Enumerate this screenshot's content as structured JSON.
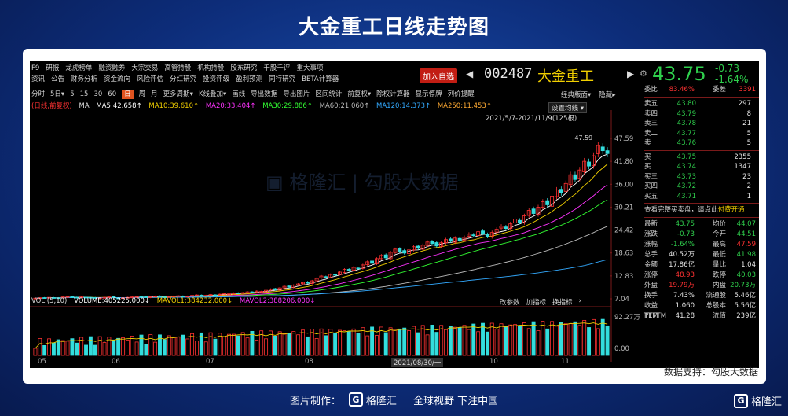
{
  "page": {
    "title": "大金重工日线走势图",
    "data_source": "数据支持：勾股大数据",
    "footer_made_by": "图片制作：",
    "footer_brand": "格隆汇",
    "footer_slogan": "全球视野 下注中国",
    "corner_brand": "格隆汇"
  },
  "nav": {
    "row1": [
      "F9",
      "研报",
      "龙虎榜单",
      "融资融券",
      "大宗交易",
      "高管持股",
      "机构持股",
      "股东研究",
      "千股千评",
      "重大事项"
    ],
    "row2": [
      "资讯",
      "公告",
      "财务分析",
      "资金流向",
      "风险评估",
      "分红研究",
      "投资评级",
      "盈利预测",
      "同行研究",
      "BETA计算器"
    ]
  },
  "header": {
    "add_fav": "加入自选",
    "code": "002487",
    "name": "大金重工",
    "price": "43.75",
    "change": "-0.73",
    "change_pct": "-1.64%"
  },
  "toolbar": {
    "periods": [
      "分时",
      "5日▾",
      "5",
      "15",
      "30",
      "60",
      "日",
      "周",
      "月",
      "更多周期▾",
      "K线叠加▾",
      "画线",
      "导出数据",
      "导出图片",
      "区间统计",
      "前复权▾",
      "除权计算器",
      "显示停牌",
      "列价提醒"
    ],
    "active": "日",
    "right": [
      "经典版面▾",
      "隐藏▸"
    ]
  },
  "ma_line": {
    "label": "(日线,前复权)",
    "ma": "MA",
    "ma5": "MA5:42.658↑",
    "ma10": "MA10:39.610↑",
    "ma20": "MA20:33.404↑",
    "ma30": "MA30:29.886↑",
    "ma60": "MA60:21.060↑",
    "ma120": "MA120:14.373↑",
    "ma250": "MA250:11.453↑"
  },
  "chart_overlay": {
    "set_ma": "设置均线 ▾",
    "range": "2021/5/7-2021/11/9(125根)",
    "peak_label": "47.59"
  },
  "chart_data": {
    "type": "candlestick",
    "y_ticks": [
      "47.59",
      "41.80",
      "36.00",
      "30.21",
      "24.42",
      "18.63",
      "12.83",
      "7.04"
    ],
    "ylim": [
      7.04,
      47.59
    ],
    "x_ticks": [
      "05",
      "06",
      "07",
      "08",
      "2021/08/30/一",
      "10",
      "11"
    ],
    "closes": [
      7.2,
      7.3,
      7.2,
      7.4,
      7.3,
      7.2,
      7.5,
      7.6,
      7.4,
      7.3,
      7.5,
      7.4,
      7.3,
      7.2,
      7.3,
      7.4,
      7.5,
      7.3,
      7.2,
      7.3,
      7.4,
      7.5,
      7.6,
      7.5,
      7.4,
      7.6,
      7.7,
      7.6,
      7.5,
      7.6,
      7.7,
      7.8,
      7.6,
      7.7,
      7.9,
      8.0,
      7.8,
      7.9,
      8.1,
      8.0,
      8.2,
      8.4,
      8.3,
      8.5,
      8.4,
      8.6,
      8.8,
      8.7,
      9.0,
      8.9,
      9.2,
      9.5,
      9.3,
      9.8,
      10.2,
      10.0,
      10.5,
      10.8,
      11.2,
      11.0,
      11.6,
      12.2,
      12.8,
      12.5,
      13.2,
      13.0,
      13.8,
      14.5,
      14.2,
      15.0,
      14.8,
      15.6,
      16.4,
      16.0,
      17.2,
      18.0,
      17.4,
      18.8,
      19.6,
      19.0,
      18.6,
      19.4,
      20.2,
      19.8,
      20.6,
      21.4,
      21.0,
      20.4,
      21.2,
      22.0,
      21.6,
      22.4,
      21.8,
      22.6,
      23.4,
      23.0,
      24.0,
      23.6,
      22.8,
      23.8,
      24.6,
      25.4,
      24.8,
      26.0,
      27.2,
      26.4,
      28.0,
      29.4,
      28.6,
      30.2,
      31.6,
      30.8,
      33.0,
      34.6,
      33.8,
      36.2,
      38.4,
      37.2,
      39.6,
      41.8,
      40.6,
      43.2,
      45.8,
      44.48,
      43.75
    ],
    "vol_header": {
      "label": "VOL (5,10)",
      "volume": "VOLUME:405225.000↓",
      "mavol1": "MAVOL1:384232.000↓",
      "mavol2": "MAVOL2:388206.000↓"
    },
    "vol_ticks": [
      "92.27万",
      "0.00"
    ],
    "vol_buttons": [
      "改参数",
      "加指标",
      "换指标",
      "›"
    ]
  },
  "orderbook": {
    "weibi": {
      "k": "委比",
      "v": "83.46%",
      "k2": "委差",
      "v2": "3391"
    },
    "asks": [
      {
        "label": "卖五",
        "price": "43.80",
        "vol": "297"
      },
      {
        "label": "卖四",
        "price": "43.79",
        "vol": "8"
      },
      {
        "label": "卖三",
        "price": "43.78",
        "vol": "21"
      },
      {
        "label": "卖二",
        "price": "43.77",
        "vol": "5"
      },
      {
        "label": "卖一",
        "price": "43.76",
        "vol": "5"
      }
    ],
    "bids": [
      {
        "label": "买一",
        "price": "43.75",
        "vol": "2355"
      },
      {
        "label": "买二",
        "price": "43.74",
        "vol": "1347"
      },
      {
        "label": "买三",
        "price": "43.73",
        "vol": "23"
      },
      {
        "label": "买四",
        "price": "43.72",
        "vol": "2"
      },
      {
        "label": "买五",
        "price": "43.71",
        "vol": "1"
      }
    ],
    "hint": "查看完整买卖盘，请点此",
    "hint_link": "付费开通",
    "stats": [
      {
        "k": "最新",
        "v": "43.75",
        "vc": "green",
        "k2": "均价",
        "v2": "44.07",
        "v2c": "green"
      },
      {
        "k": "涨跌",
        "v": "-0.73",
        "vc": "green",
        "k2": "今开",
        "v2": "44.51",
        "v2c": "green"
      },
      {
        "k": "涨幅",
        "v": "-1.64%",
        "vc": "green",
        "k2": "最高",
        "v2": "47.59",
        "v2c": "red"
      },
      {
        "k": "总手",
        "v": "40.52万",
        "vc": "white",
        "k2": "最低",
        "v2": "41.98",
        "v2c": "green"
      },
      {
        "k": "金额",
        "v": "17.86亿",
        "vc": "white",
        "k2": "量比",
        "v2": "1.04",
        "v2c": "white"
      },
      {
        "k": "涨停",
        "v": "48.93",
        "vc": "red",
        "k2": "跌停",
        "v2": "40.03",
        "v2c": "green"
      },
      {
        "k": "外盘",
        "v": "19.79万",
        "vc": "red",
        "k2": "内盘",
        "v2": "20.73万",
        "v2c": "green"
      },
      {
        "k": "换手",
        "v": "7.43%",
        "vc": "white",
        "k2": "流通股",
        "v2": "5.46亿",
        "v2c": "white"
      },
      {
        "k": "收益TTM",
        "v": "1.060",
        "vc": "white",
        "k2": "总股本",
        "v2": "5.56亿",
        "v2c": "white"
      },
      {
        "k": "PETTM",
        "v": "41.28",
        "vc": "white",
        "k2": "流值",
        "v2": "239亿",
        "v2c": "white"
      }
    ]
  },
  "colors": {
    "up": "#ff3232",
    "down": "#2fd04d",
    "ma5": "#ffffff",
    "ma10": "#f2d000",
    "ma20": "#ff33ff",
    "ma30": "#33ff33",
    "ma60": "#bbbbbb",
    "ma120": "#33aaff",
    "ma250": "#ffaa33"
  }
}
